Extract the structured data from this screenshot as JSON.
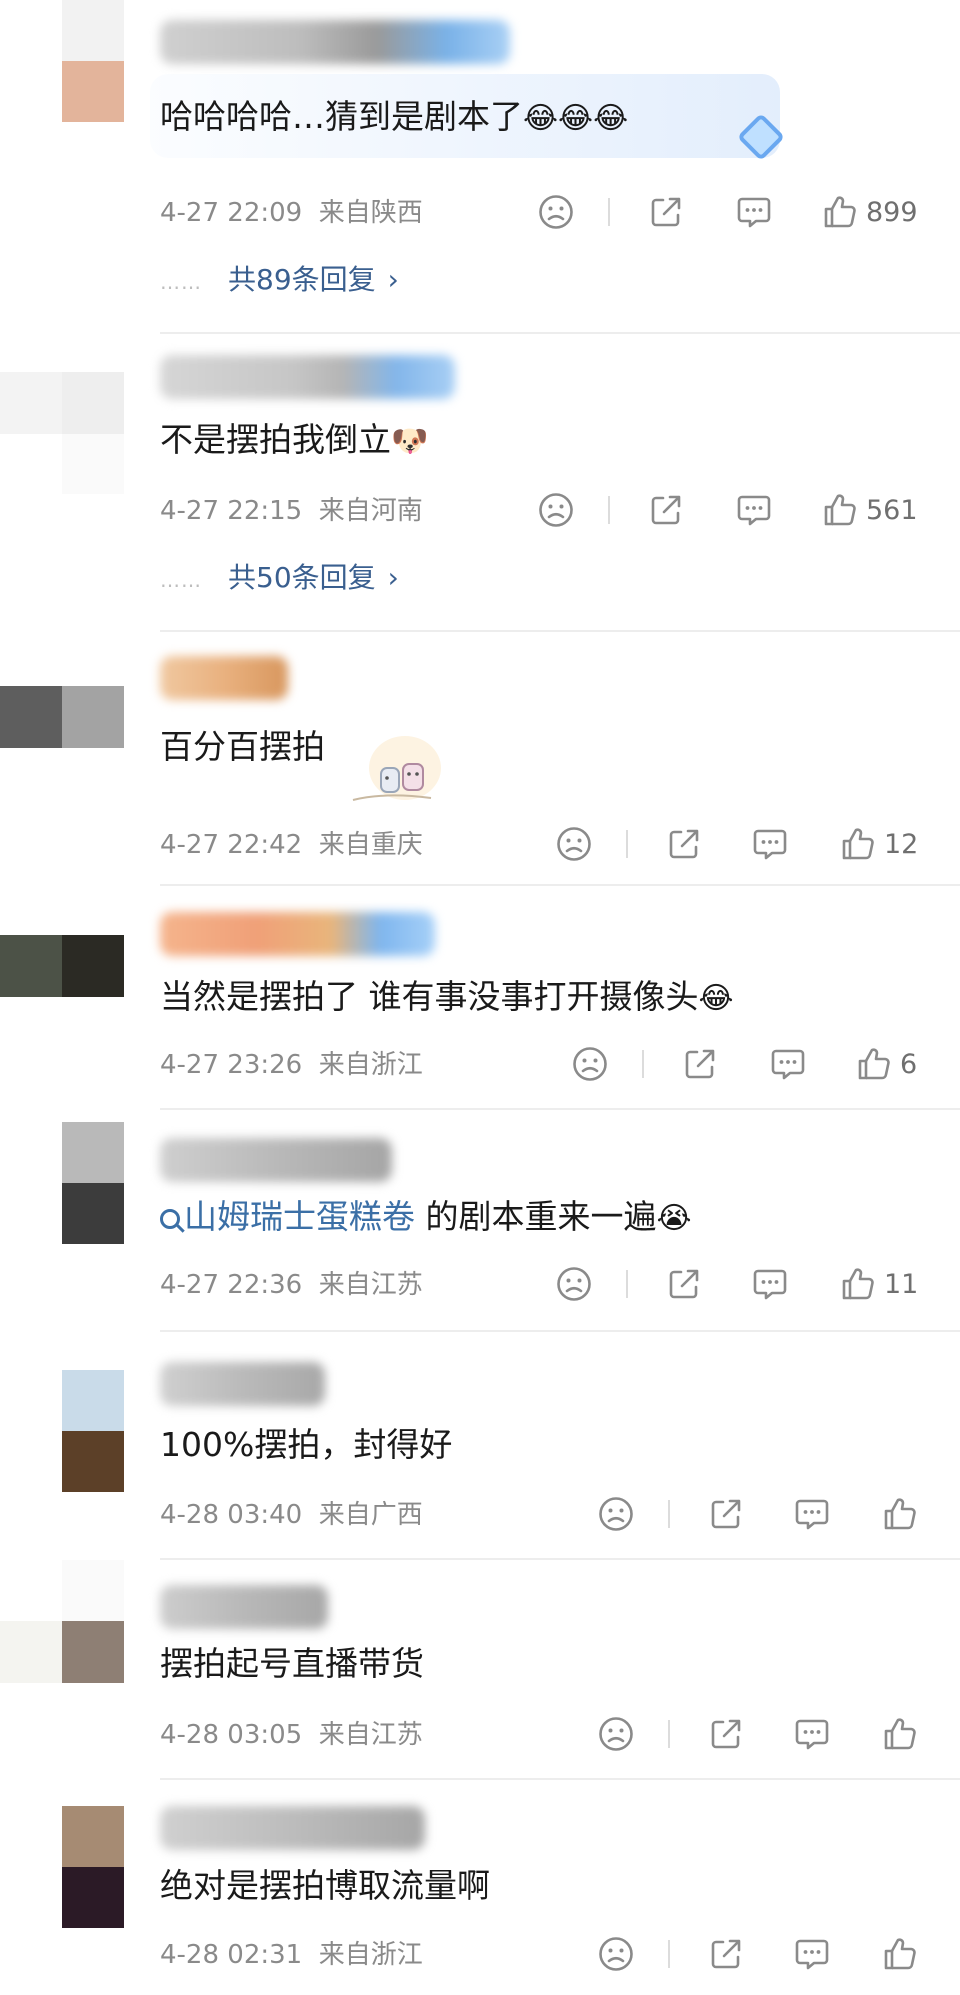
{
  "comments": [
    {
      "text": "哈哈哈哈…猜到是剧本了",
      "text_emoji": "😂😂😂",
      "time": "4-27 22:09",
      "location": "来自陕西",
      "likes": "899",
      "replies": "共89条回复",
      "replies_chevron": "›",
      "replies_dots": "……"
    },
    {
      "text": "不是摆拍我倒立",
      "text_emoji": "🐶",
      "time": "4-27 22:15",
      "location": "来自河南",
      "likes": "561",
      "replies": "共50条回复",
      "replies_chevron": "›",
      "replies_dots": "……"
    },
    {
      "text": "百分百摆拍",
      "time": "4-27 22:42",
      "location": "来自重庆",
      "likes": "12"
    },
    {
      "text": "当然是摆拍了 谁有事没事打开摄像头",
      "text_emoji": "😂",
      "time": "4-27 23:26",
      "location": "来自浙江",
      "likes": "6"
    },
    {
      "link": "山姆瑞士蛋糕卷",
      "text": " 的剧本重来一遍",
      "text_emoji": "😭",
      "time": "4-27 22:36",
      "location": "来自江苏",
      "likes": "11"
    },
    {
      "text": "100%摆拍，封得好",
      "time": "4-28 03:40",
      "location": "来自广西",
      "likes": ""
    },
    {
      "text": "摆拍起号直播带货",
      "time": "4-28 03:05",
      "location": "来自江苏",
      "likes": ""
    },
    {
      "text": "绝对是摆拍博取流量啊",
      "time": "4-28 02:31",
      "location": "来自浙江",
      "likes": ""
    }
  ],
  "icons": {
    "dislike": "frown-face-icon",
    "share": "share-icon",
    "comment": "comment-bubble-icon",
    "like": "thumbs-up-icon"
  },
  "colors": {
    "text": "#1a1a1a",
    "meta": "#8a8a8a",
    "link": "#3b6fa6",
    "replies": "#3a5f8f",
    "divider": "#ededed"
  }
}
